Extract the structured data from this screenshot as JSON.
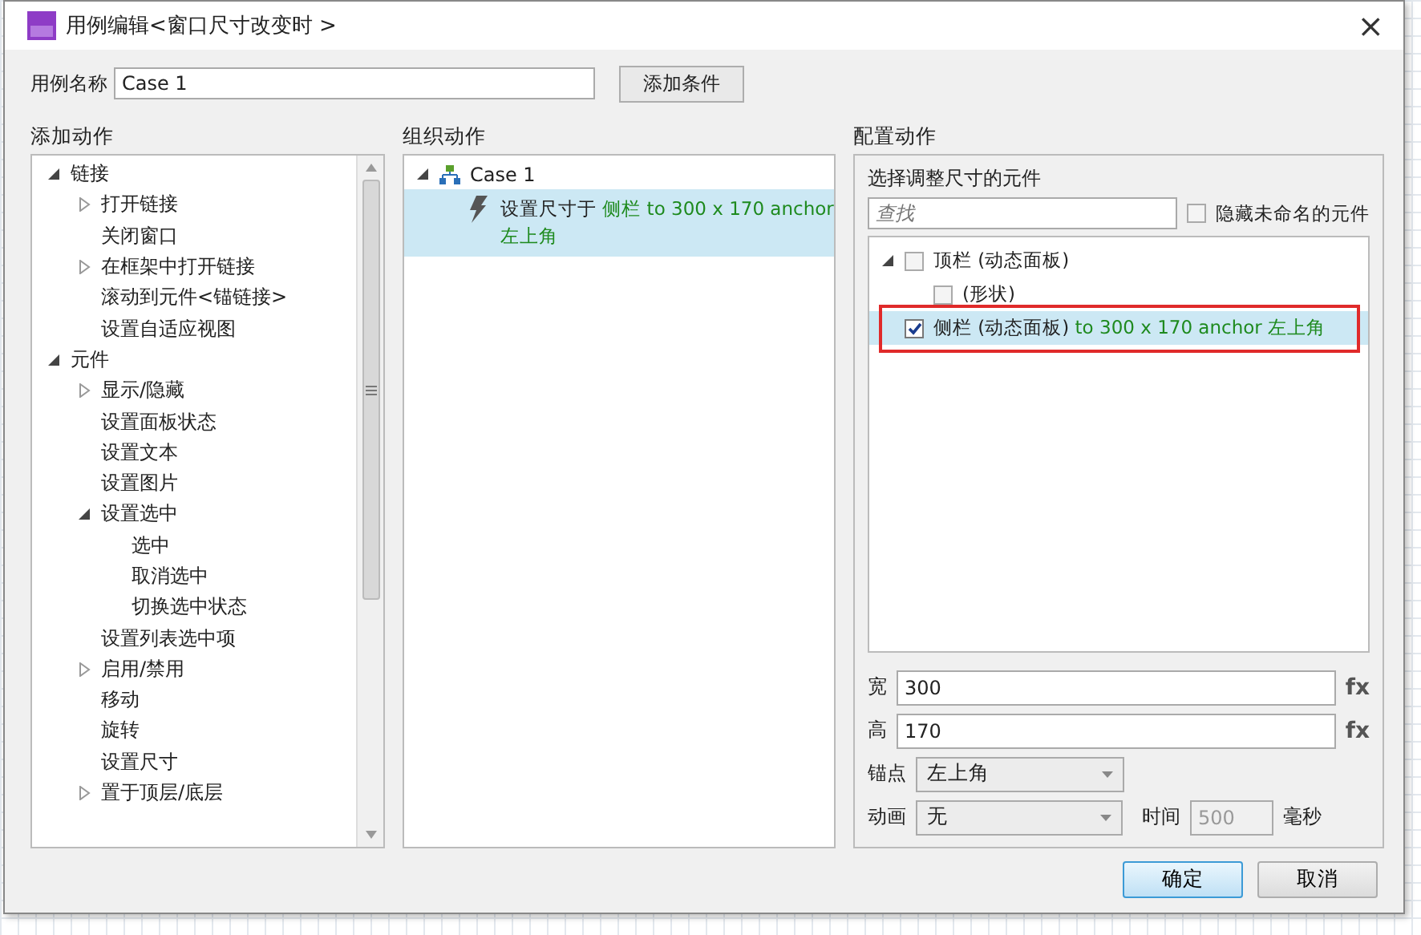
{
  "window": {
    "title": "用例编辑<窗口尺寸改变时 >",
    "close": "×"
  },
  "case_name": {
    "label": "用例名称",
    "value": "Case 1",
    "button": "添加条件"
  },
  "add_actions": {
    "heading": "添加动作",
    "items": [
      {
        "label": "链接",
        "expanded": true,
        "children": [
          {
            "label": "打开链接",
            "expanded": false
          },
          {
            "label": "关闭窗口"
          },
          {
            "label": "在框架中打开链接",
            "expanded": false
          },
          {
            "label": "滚动到元件<锚链接>"
          },
          {
            "label": "设置自适应视图"
          }
        ]
      },
      {
        "label": "元件",
        "expanded": true,
        "children": [
          {
            "label": "显示/隐藏",
            "expanded": false
          },
          {
            "label": "设置面板状态"
          },
          {
            "label": "设置文本"
          },
          {
            "label": "设置图片"
          },
          {
            "label": "设置选中",
            "expanded": true,
            "children": [
              {
                "label": "选中"
              },
              {
                "label": "取消选中"
              },
              {
                "label": "切换选中状态"
              }
            ]
          },
          {
            "label": "设置列表选中项"
          },
          {
            "label": "启用/禁用",
            "expanded": false
          },
          {
            "label": "移动"
          },
          {
            "label": "旋转"
          },
          {
            "label": "设置尺寸"
          },
          {
            "label": "置于顶层/底层",
            "expanded": false
          }
        ]
      }
    ]
  },
  "organize_actions": {
    "heading": "组织动作",
    "cases": [
      {
        "label": "Case 1",
        "expanded": true,
        "actions": [
          {
            "selected": true,
            "segments": [
              {
                "kind": "plain",
                "text": "设置尺寸于 "
              },
              {
                "kind": "value",
                "text": "侧栏"
              },
              {
                "kind": "value",
                "text": " to 300 x 170 anchor "
              },
              {
                "kind": "value",
                "text": "左上角"
              }
            ]
          }
        ]
      }
    ]
  },
  "configure": {
    "heading": "配置动作",
    "widget_label": "选择调整尺寸的元件",
    "search": {
      "placeholder": "查找"
    },
    "hide_unnamed": {
      "label": "隐藏未命名的元件",
      "checked": false
    },
    "widgets": [
      {
        "label": "顶栏 (动态面板)",
        "checked": false,
        "expanded": true,
        "selected": false,
        "children": [
          {
            "label": "(形状)",
            "checked": false,
            "selected": false
          }
        ]
      },
      {
        "label": "侧栏 (动态面板)",
        "detail": " to 300 x 170 anchor 左上角",
        "checked": true,
        "selected": true,
        "highlighted": true
      }
    ],
    "width": {
      "label": "宽",
      "value": "300",
      "fx": "fx"
    },
    "height": {
      "label": "高",
      "value": "170",
      "fx": "fx"
    },
    "anchor": {
      "label": "锚点",
      "value": "左上角"
    },
    "animation": {
      "label": "动画",
      "value": "无",
      "time_label": "时间",
      "time_value": "500",
      "unit": "毫秒",
      "time_disabled": true
    }
  },
  "buttons": [
    {
      "label": "确定",
      "kind": "primary"
    },
    {
      "label": "取消",
      "kind": "normal"
    }
  ]
}
